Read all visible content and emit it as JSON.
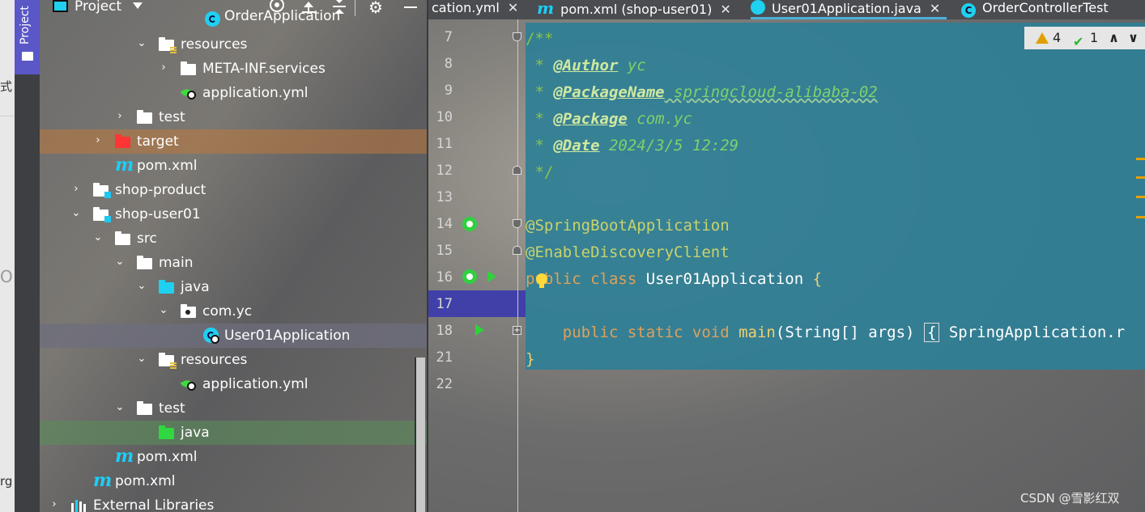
{
  "outer_strip": {
    "fragments": [
      "式",
      "O",
      "rg"
    ]
  },
  "tool_window": {
    "label": "Project"
  },
  "project_panel": {
    "title": "Project",
    "tree": [
      {
        "id": "r0",
        "label": "OrderApplication",
        "icon": "spring-class-icon"
      },
      {
        "id": "r1",
        "label": "resources",
        "icon": "resources-folder-icon",
        "expanded": true
      },
      {
        "id": "r2",
        "label": "META-INF.services",
        "icon": "folder-icon",
        "expanded": false
      },
      {
        "id": "r3",
        "label": "application.yml",
        "icon": "spring-yml-icon"
      },
      {
        "id": "r4",
        "label": "test",
        "icon": "folder-icon",
        "expanded": false
      },
      {
        "id": "r5",
        "label": "target",
        "icon": "excluded-folder-icon",
        "expanded": false
      },
      {
        "id": "r6",
        "label": "pom.xml",
        "icon": "maven-icon"
      },
      {
        "id": "r7",
        "label": "shop-product",
        "icon": "module-folder-icon",
        "expanded": false
      },
      {
        "id": "r8",
        "label": "shop-user01",
        "icon": "module-folder-icon",
        "expanded": true
      },
      {
        "id": "r9",
        "label": "src",
        "icon": "folder-icon",
        "expanded": true
      },
      {
        "id": "r10",
        "label": "main",
        "icon": "folder-icon",
        "expanded": true
      },
      {
        "id": "r11",
        "label": "java",
        "icon": "source-folder-icon",
        "expanded": true
      },
      {
        "id": "r12",
        "label": "com.yc",
        "icon": "package-icon",
        "expanded": true
      },
      {
        "id": "r13",
        "label": "User01Application",
        "icon": "spring-class-icon"
      },
      {
        "id": "r14",
        "label": "resources",
        "icon": "resources-folder-icon",
        "expanded": true
      },
      {
        "id": "r15",
        "label": "application.yml",
        "icon": "spring-yml-icon"
      },
      {
        "id": "r16",
        "label": "test",
        "icon": "folder-icon",
        "expanded": true
      },
      {
        "id": "r17",
        "label": "java",
        "icon": "test-source-folder-icon"
      },
      {
        "id": "r18",
        "label": "pom.xml",
        "icon": "maven-icon"
      },
      {
        "id": "r19",
        "label": "pom.xml",
        "icon": "maven-icon"
      },
      {
        "id": "r20",
        "label": "External Libraries",
        "icon": "libraries-icon",
        "expanded": false
      }
    ]
  },
  "tabs": [
    {
      "label": "cation.yml",
      "icon": "spring-yml-icon"
    },
    {
      "label": "pom.xml (shop-user01)",
      "icon": "maven-icon",
      "m": "m"
    },
    {
      "label": "User01Application.java",
      "icon": "spring-class-icon",
      "active": true
    },
    {
      "label": "OrderControllerTest",
      "icon": "class-icon",
      "c": "C"
    }
  ],
  "tab_close": "✕",
  "inspection": {
    "warnings": "4",
    "weak_warnings": "1",
    "up": "∧",
    "down": "∨"
  },
  "editor": {
    "line_numbers": [
      "7",
      "8",
      "9",
      "10",
      "11",
      "12",
      "13",
      "14",
      "15",
      "16",
      "17",
      "18",
      "21",
      "22"
    ],
    "lines": {
      "l7": "/**",
      "l8_star": " * ",
      "l8_tag": "@Author",
      "l8_val": " yc",
      "l9_star": " * ",
      "l9_tag": "@PackageName",
      "l9_val": " springcloud-alibaba-02",
      "l10_star": " * ",
      "l10_tag": "@Package",
      "l10_val": " com.yc",
      "l11_star": " * ",
      "l11_tag": "@Date",
      "l11_val": " 2024/3/5 12:29",
      "l12": " */",
      "l14": "@SpringBootApplication",
      "l15": "@EnableDiscoveryClient",
      "l16_kw": "public class ",
      "l16_name": "User01Application ",
      "l16_brace": "{",
      "l18_kw": "    public static void ",
      "l18_name": "main",
      "l18_paren": "(",
      "l18_type": "String[] args",
      "l18_close": ")",
      "l18_brace": "{",
      "l18_rest": " SpringApplication.r",
      "l21": "}"
    }
  },
  "watermark": "CSDN @雪影红双",
  "colors": {
    "accent": "#5a57c7",
    "code_bg": "#2f7f96",
    "warning": "#e0a000"
  }
}
